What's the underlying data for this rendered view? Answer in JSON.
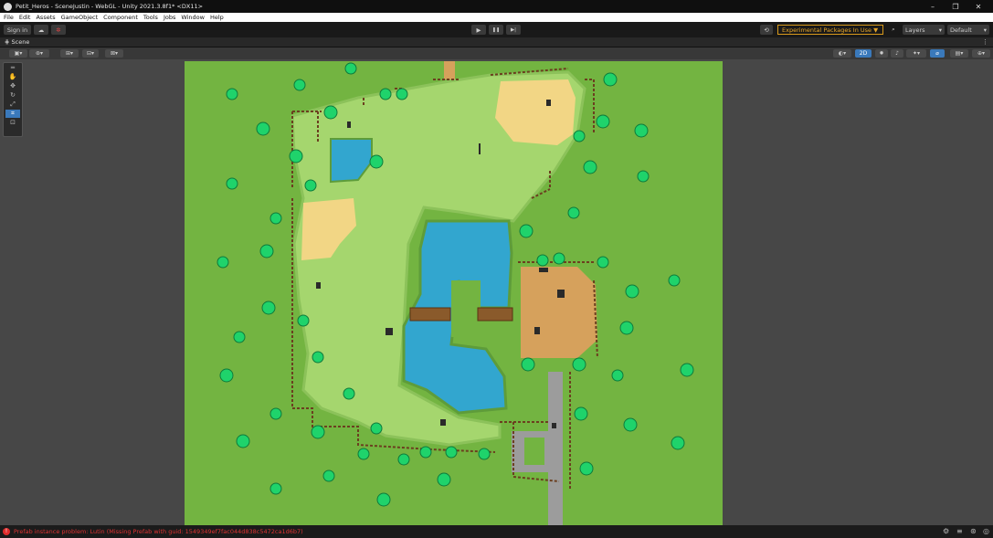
{
  "window": {
    "title": "Petit_Heros - SceneJustin - WebGL - Unity 2021.3.8f1* <DX11>",
    "minimize": "–",
    "maximize": "❐",
    "close": "✕"
  },
  "menu": [
    "File",
    "Edit",
    "Assets",
    "GameObject",
    "Component",
    "Tools",
    "Jobs",
    "Window",
    "Help"
  ],
  "toolbar": {
    "sign_in": "Sign in",
    "play": "▶",
    "pause": "❚❚",
    "step": "▶|",
    "experimental": "Experimental Packages In Use ▼",
    "layers": "Layers",
    "layout": "Default"
  },
  "scene_tab": {
    "label": "Scene"
  },
  "scene_bar": {
    "mode_2d": "2D"
  },
  "status": {
    "message": "Prefab instance problem: Lutin (Missing Prefab with guid: 1549349ef7fac044d838c5472ca1d6b7)"
  },
  "colors": {
    "grass": "#73b441",
    "light_grass": "#a5d66e",
    "water": "#32a6cf",
    "sand": "#f2d685",
    "dirt": "#d6a15c",
    "tree": "#1fd36b",
    "fence": "#6b3f1f",
    "path": "#9c9c9c",
    "accent_orange": "#e8a628",
    "error_red": "#e02c2c"
  }
}
